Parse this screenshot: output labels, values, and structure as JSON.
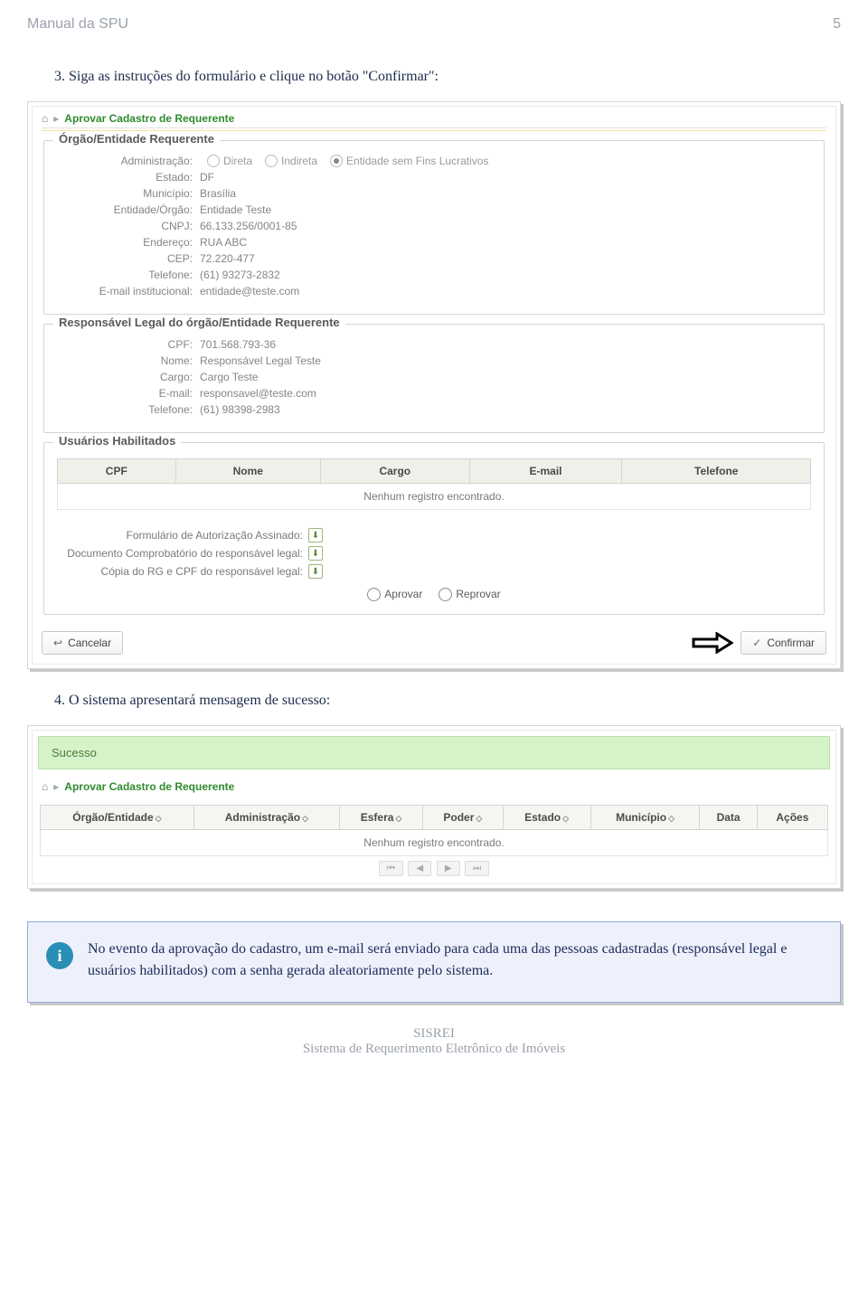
{
  "doc_title": "Manual da SPU",
  "page_number": "5",
  "step3": "3.   Siga as instruções do formulário e clique no botão \"Confirmar\":",
  "step4": "4.   O sistema apresentará mensagem de sucesso:",
  "crumb": {
    "home": "⌂",
    "sep": "▸",
    "current": "Aprovar Cadastro de Requerente"
  },
  "entity": {
    "legend": "Órgão/Entidade Requerente",
    "admin_label": "Administração:",
    "radios": {
      "direta": "Direta",
      "indireta": "Indireta",
      "sem_fins": "Entidade sem Fins Lucrativos"
    },
    "fields": {
      "estado_label": "Estado:",
      "estado": "DF",
      "municipio_label": "Município:",
      "municipio": "Brasília",
      "orgao_label": "Entidade/Órgão:",
      "orgao": "Entidade Teste",
      "cnpj_label": "CNPJ:",
      "cnpj": "66.133.256/0001-85",
      "endereco_label": "Endereço:",
      "endereco": "RUA ABC",
      "cep_label": "CEP:",
      "cep": "72.220-477",
      "tel_label": "Telefone:",
      "tel": "(61) 93273-2832",
      "email_label": "E-mail institucional:",
      "email": "entidade@teste.com"
    }
  },
  "responsavel": {
    "legend": "Responsável Legal do órgão/Entidade Requerente",
    "fields": {
      "cpf_label": "CPF:",
      "cpf": "701.568.793-36",
      "nome_label": "Nome:",
      "nome": "Responsável Legal Teste",
      "cargo_label": "Cargo:",
      "cargo": "Cargo Teste",
      "email_label": "E-mail:",
      "email": "responsavel@teste.com",
      "tel_label": "Telefone:",
      "tel": "(61) 98398-2983"
    }
  },
  "usuarios": {
    "legend": "Usuários Habilitados",
    "cols": {
      "cpf": "CPF",
      "nome": "Nome",
      "cargo": "Cargo",
      "email": "E-mail",
      "tel": "Telefone"
    },
    "empty": "Nenhum registro encontrado."
  },
  "attachments": {
    "form_assinado": "Formulário de Autorização Assinado:",
    "doc_compr": "Documento Comprobatório do responsável legal:",
    "rg_cpf": "Cópia do RG e CPF do responsável legal:"
  },
  "decision": {
    "aprovar": "Aprovar",
    "reprovar": "Reprovar"
  },
  "actions": {
    "cancel": "Cancelar",
    "confirm": "Confirmar"
  },
  "success_text": "Sucesso",
  "list_cols": {
    "orgao": "Órgão/Entidade",
    "admin": "Administração",
    "esfera": "Esfera",
    "poder": "Poder",
    "estado": "Estado",
    "municipio": "Município",
    "data": "Data",
    "acoes": "Ações"
  },
  "list_empty": "Nenhum registro encontrado.",
  "info_text": "No evento da aprovação do cadastro, um e-mail será enviado para cada uma das pessoas cadastradas (responsável legal e usuários habilitados) com a senha gerada aleatoriamente pelo sistema.",
  "footer_line1": "SISREI",
  "footer_line2": "Sistema de Requerimento Eletrônico de Imóveis"
}
